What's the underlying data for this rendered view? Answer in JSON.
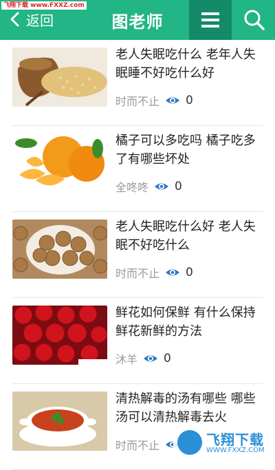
{
  "header": {
    "back_label": "返回",
    "title": "图老师",
    "accent": "#22b585",
    "menu_bg": "#138a68"
  },
  "watermark_top": "飞翔下载 www.FXXZ.com",
  "articles": [
    {
      "title": "老人失眠吃什么 老年人失眠睡不好吃什么好",
      "author": "时而不止",
      "views": "0",
      "image": "grain-sack"
    },
    {
      "title": "橘子可以多吃吗 橘子吃多了有哪些坏处",
      "author": "全咚咚",
      "views": "0",
      "image": "tangerines"
    },
    {
      "title": "老人失眠吃什么好 老人失眠不好吃什么",
      "author": "时而不止",
      "views": "0",
      "image": "walnuts"
    },
    {
      "title": "鲜花如何保鲜 有什么保持鲜花新鲜的方法",
      "author": "沐羊",
      "views": "0",
      "image": "red-roses"
    },
    {
      "title": "清热解毒的汤有哪些 哪些汤可以清热解毒去火",
      "author": "时而不止",
      "views": "0",
      "image": "soup-bowl"
    }
  ],
  "watermark_bottom": {
    "text": "飞翔下载",
    "url": "WWW.FXXZ.COM"
  }
}
